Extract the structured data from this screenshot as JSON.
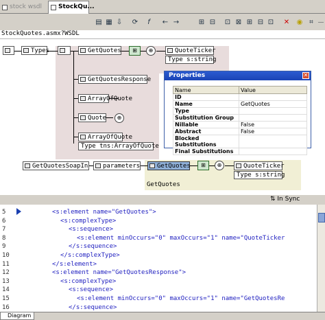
{
  "tabs": [
    {
      "label": "stock wsdl"
    },
    {
      "label": "StockQu..."
    }
  ],
  "address": "StockQuotes.asmx?WSDL",
  "diagram": {
    "root": "",
    "types": "Types",
    "nodes": {
      "getquotes": "GetQuotes",
      "quoteticker": "QuoteTicker",
      "quoteticker_type": "Type s:string",
      "getquotesresponse": "GetQuotesResponse",
      "arrayofquote": "ArrayOfQuote",
      "quote": "Quote",
      "arrayofquote2": "ArrayOfQuote",
      "arrayofquote2_type": "Type tns:ArrayOfQuote",
      "soapin": "GetQuotesSoapIn",
      "parameters": "parameters",
      "getquotes2": "GetQuotes",
      "quoteticker2": "QuoteTicker",
      "quoteticker2_type": "Type s:string",
      "group_label": "GetQuotes"
    }
  },
  "properties": {
    "title": "Properties",
    "headers": [
      "Name",
      "Value"
    ],
    "rows": [
      [
        "ID",
        ""
      ],
      [
        "Name",
        "GetQuotes"
      ],
      [
        "Type",
        ""
      ],
      [
        "Substitution Group",
        ""
      ],
      [
        "Nillable",
        "False"
      ],
      [
        "Abstract",
        "False"
      ],
      [
        "Blocked Substitutions",
        ""
      ],
      [
        "Final Substitutions",
        ""
      ]
    ]
  },
  "status": {
    "sync": "In Sync"
  },
  "code": {
    "line_numbers": [
      "5",
      "6",
      "7",
      "8",
      "9",
      "10",
      "11",
      "12",
      "13",
      "14",
      "15",
      "16"
    ],
    "lines": [
      "<s:element name=\"GetQuotes\">",
      "<s:complexType>",
      "<s:sequence>",
      "<s:element minOccurs=\"0\" maxOccurs=\"1\" name=\"QuoteTicker",
      "</s:sequence>",
      "</s:complexType>",
      "</s:element>",
      "<s:element name=\"GetQuotesResponse\">",
      "<s:complexType>",
      "<s:sequence>",
      "<s:element minOccurs=\"0\" maxOccurs=\"1\" name=\"GetQuotesRe",
      "</s:sequence>"
    ]
  },
  "bottom_tab": "Diagram"
}
